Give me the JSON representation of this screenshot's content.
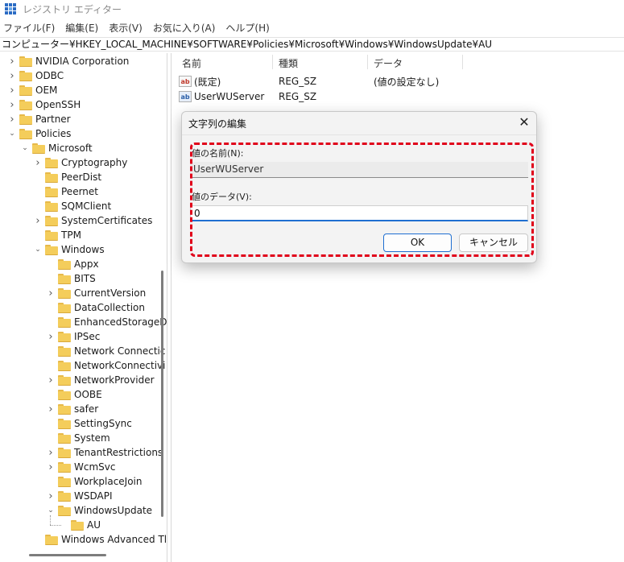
{
  "window": {
    "title": "レジストリ エディター"
  },
  "menu": [
    "ファイル(F)",
    "編集(E)",
    "表示(V)",
    "お気に入り(A)",
    "ヘルプ(H)"
  ],
  "address": "コンピューター¥HKEY_LOCAL_MACHINE¥SOFTWARE¥Policies¥Microsoft¥Windows¥WindowsUpdate¥AU",
  "tree": [
    {
      "label": "NVIDIA Corporation",
      "level": 0,
      "chevron": "right"
    },
    {
      "label": "ODBC",
      "level": 0,
      "chevron": "right"
    },
    {
      "label": "OEM",
      "level": 0,
      "chevron": "right"
    },
    {
      "label": "OpenSSH",
      "level": 0,
      "chevron": "right"
    },
    {
      "label": "Partner",
      "level": 0,
      "chevron": "right"
    },
    {
      "label": "Policies",
      "level": 0,
      "chevron": "down"
    },
    {
      "label": "Microsoft",
      "level": 1,
      "chevron": "down"
    },
    {
      "label": "Cryptography",
      "level": 2,
      "chevron": "right"
    },
    {
      "label": "PeerDist",
      "level": 2,
      "chevron": "none"
    },
    {
      "label": "Peernet",
      "level": 2,
      "chevron": "none"
    },
    {
      "label": "SQMClient",
      "level": 2,
      "chevron": "none"
    },
    {
      "label": "SystemCertificates",
      "level": 2,
      "chevron": "right"
    },
    {
      "label": "TPM",
      "level": 2,
      "chevron": "none"
    },
    {
      "label": "Windows",
      "level": 2,
      "chevron": "down"
    },
    {
      "label": "Appx",
      "level": 3,
      "chevron": "none"
    },
    {
      "label": "BITS",
      "level": 3,
      "chevron": "none"
    },
    {
      "label": "CurrentVersion",
      "level": 3,
      "chevron": "right"
    },
    {
      "label": "DataCollection",
      "level": 3,
      "chevron": "none"
    },
    {
      "label": "EnhancedStorageD",
      "level": 3,
      "chevron": "none"
    },
    {
      "label": "IPSec",
      "level": 3,
      "chevron": "right"
    },
    {
      "label": "Network Connectic",
      "level": 3,
      "chevron": "none"
    },
    {
      "label": "NetworkConnectivi",
      "level": 3,
      "chevron": "none"
    },
    {
      "label": "NetworkProvider",
      "level": 3,
      "chevron": "right"
    },
    {
      "label": "OOBE",
      "level": 3,
      "chevron": "none"
    },
    {
      "label": "safer",
      "level": 3,
      "chevron": "right"
    },
    {
      "label": "SettingSync",
      "level": 3,
      "chevron": "none"
    },
    {
      "label": "System",
      "level": 3,
      "chevron": "none"
    },
    {
      "label": "TenantRestrictions",
      "level": 3,
      "chevron": "right"
    },
    {
      "label": "WcmSvc",
      "level": 3,
      "chevron": "right"
    },
    {
      "label": "WorkplaceJoin",
      "level": 3,
      "chevron": "none"
    },
    {
      "label": "WSDAPI",
      "level": 3,
      "chevron": "right"
    },
    {
      "label": "WindowsUpdate",
      "level": 3,
      "chevron": "down"
    },
    {
      "label": "AU",
      "level": 4,
      "chevron": "none",
      "selected": true
    },
    {
      "label": "Windows Advanced Tl",
      "level": 2,
      "chevron": "none"
    }
  ],
  "values_pane": {
    "headers": {
      "name": "名前",
      "type": "種類",
      "data": "データ"
    },
    "rows": [
      {
        "icon": "ab",
        "name": "(既定)",
        "type": "REG_SZ",
        "data": "(値の設定なし)"
      },
      {
        "icon": "ab",
        "name": "UserWUServer",
        "type": "REG_SZ",
        "data": ""
      }
    ]
  },
  "dialog": {
    "title": "文字列の編集",
    "name_label": "値の名前(N):",
    "name_value": "UserWUServer",
    "data_label": "値のデータ(V):",
    "data_value": "0",
    "ok_label": "OK",
    "cancel_label": "キャンセル"
  },
  "colors": {
    "highlight": "#e0001a",
    "accent": "#1f6fd1",
    "folder": "#f4cd5b"
  }
}
